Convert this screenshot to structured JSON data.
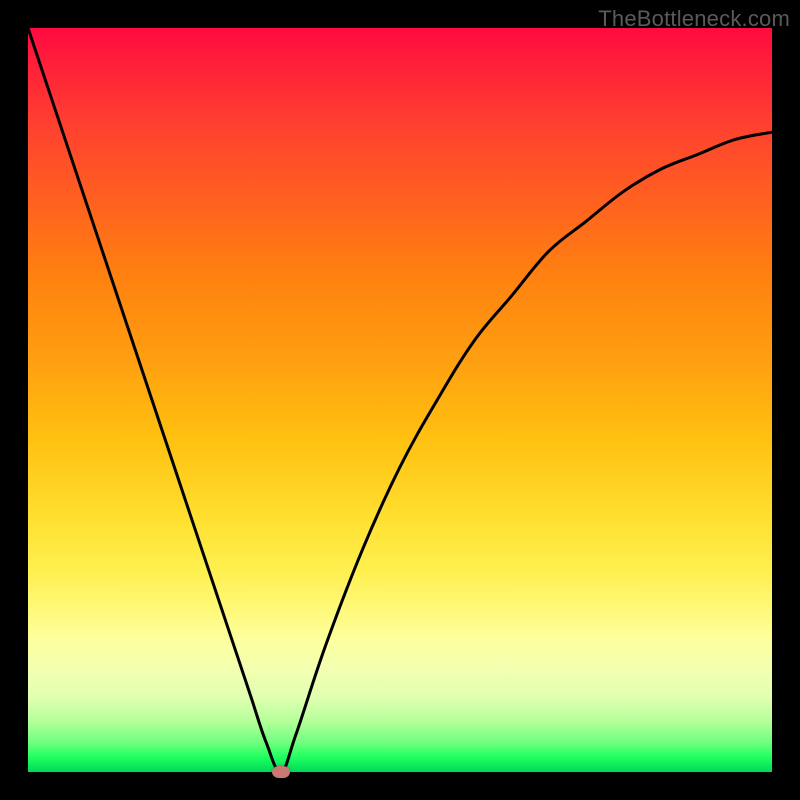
{
  "watermark": "TheBottleneck.com",
  "colors": {
    "frame_bg": "#000000",
    "curve_stroke": "#000000",
    "marker_fill": "#c77a74"
  },
  "chart_data": {
    "type": "line",
    "title": "",
    "xlabel": "",
    "ylabel": "",
    "xlim": [
      0,
      100
    ],
    "ylim": [
      0,
      100
    ],
    "grid": false,
    "legend": false,
    "annotations": [],
    "series": [
      {
        "name": "bottleneck-curve",
        "x": [
          0,
          4,
          8,
          12,
          16,
          20,
          24,
          28,
          30,
          32,
          34,
          36,
          40,
          45,
          50,
          55,
          60,
          65,
          70,
          75,
          80,
          85,
          90,
          95,
          100
        ],
        "values": [
          100,
          88,
          76,
          64,
          52,
          40,
          28,
          16,
          10,
          4,
          0,
          5,
          17,
          30,
          41,
          50,
          58,
          64,
          70,
          74,
          78,
          81,
          83,
          85,
          86
        ]
      }
    ],
    "marker": {
      "x": 34,
      "y": 0
    },
    "gradient_stops": [
      {
        "pos": 0,
        "color": "#ff0a40"
      },
      {
        "pos": 50,
        "color": "#ffc010"
      },
      {
        "pos": 80,
        "color": "#fcff9c"
      },
      {
        "pos": 100,
        "color": "#00d858"
      }
    ]
  }
}
